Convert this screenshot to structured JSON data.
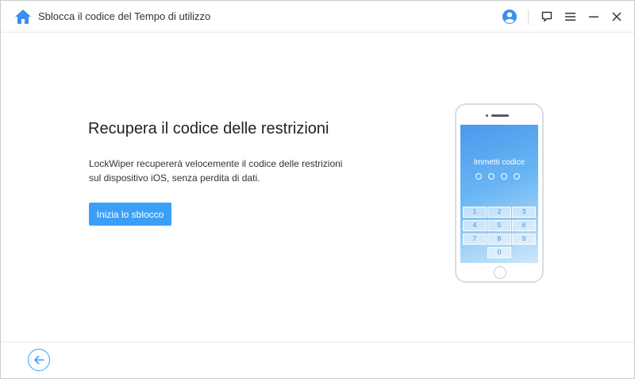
{
  "header": {
    "title": "Sblocca il codice del Tempo di utilizzo",
    "icons": {
      "home": "home-icon",
      "account": "user-icon",
      "feedback": "chat-icon",
      "menu": "menu-icon",
      "minimize": "minimize-icon",
      "close": "close-icon"
    }
  },
  "main": {
    "title": "Recupera il codice delle restrizioni",
    "description": "LockWiper recupererà velocemente il codice delle restrizioni sul dispositivo iOS, senza perdita di dati.",
    "start_button": "Inizia lo sblocco"
  },
  "phone": {
    "screen_label": "Immetti codice",
    "keys": [
      "1",
      "2",
      "3",
      "4",
      "5",
      "6",
      "7",
      "8",
      "9",
      "0"
    ]
  },
  "footer": {
    "back_icon": "arrow-left-icon"
  },
  "colors": {
    "accent": "#3a9ff7",
    "home_icon": "#3a8ff0"
  }
}
